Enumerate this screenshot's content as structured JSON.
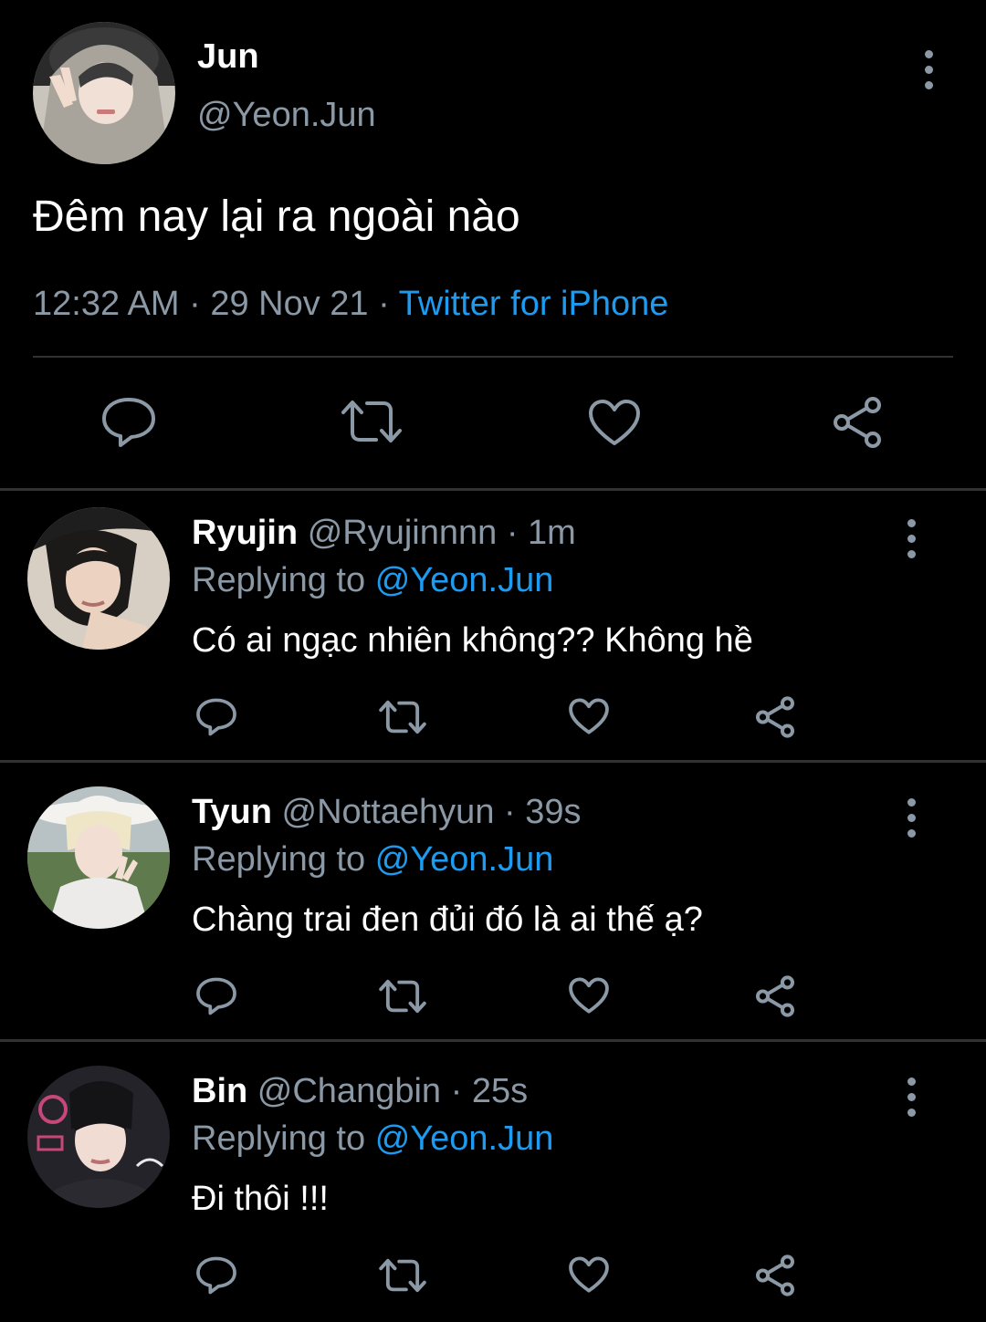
{
  "tweet": {
    "author_name": "Jun",
    "author_handle": "@Yeon.Jun",
    "text": "Đêm nay lại ra ngoài nào",
    "time": "12:32 AM",
    "date": "29 Nov 21",
    "separator": "·",
    "source": "Twitter for iPhone",
    "actions": [
      "reply-icon",
      "retweet-icon",
      "like-icon",
      "share-icon"
    ]
  },
  "replies": [
    {
      "name": "Ryujin",
      "handle": "@Ryujinnnn",
      "time": "· 1m",
      "replying_prefix": "Replying to",
      "replying_to": "@Yeon.Jun",
      "text": "Có ai ngạc nhiên không?? Không hề"
    },
    {
      "name": "Tyun",
      "handle": "@Nottaehyun",
      "time": "· 39s",
      "replying_prefix": "Replying to",
      "replying_to": "@Yeon.Jun",
      "text": "Chàng trai đen đủi đó là ai thế ạ?"
    },
    {
      "name": "Bin",
      "handle": "@Changbin",
      "time": "· 25s",
      "replying_prefix": "Replying to",
      "replying_to": "@Yeon.Jun",
      "text": "Đi thôi !!!"
    }
  ],
  "colors": {
    "background": "#000000",
    "text_primary": "#ffffff",
    "text_secondary": "#8b98a5",
    "accent": "#1d9bf0",
    "divider": "#2f3336"
  }
}
